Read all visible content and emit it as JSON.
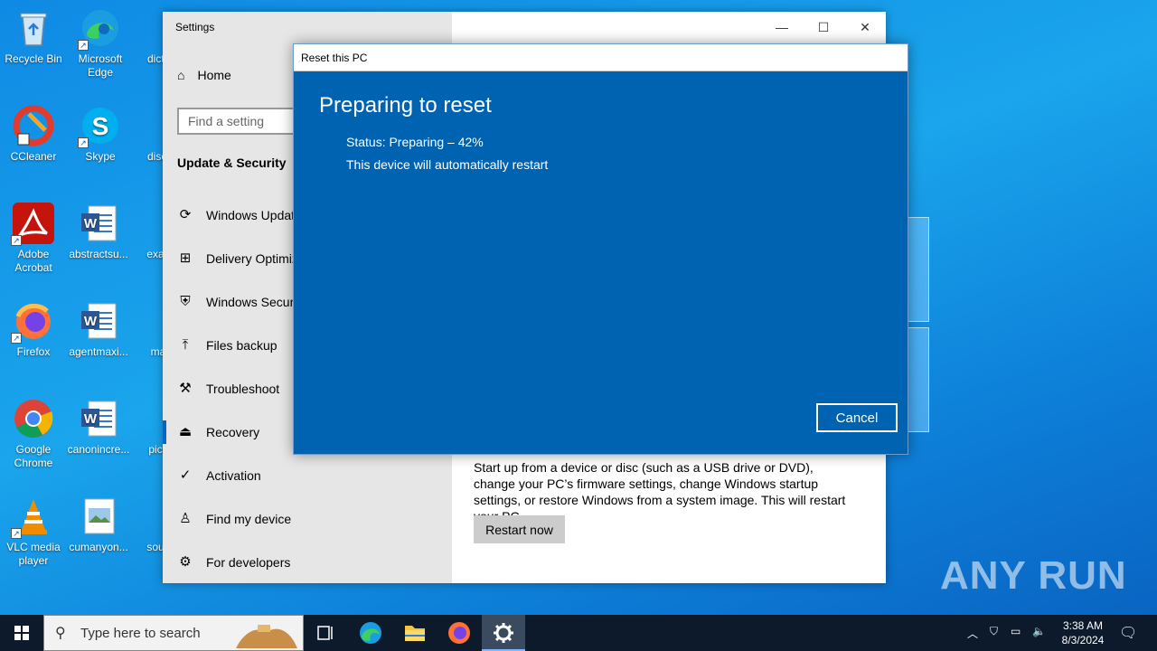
{
  "desktop": {
    "icons": [
      {
        "label": "Recycle Bin"
      },
      {
        "label": "Microsoft Edge"
      },
      {
        "label": "dictio"
      },
      {
        "label": "CCleaner"
      },
      {
        "label": "Skype"
      },
      {
        "label": "discu"
      },
      {
        "label": "Adobe Acrobat"
      },
      {
        "label": "abstractsu..."
      },
      {
        "label": "exam"
      },
      {
        "label": "Firefox"
      },
      {
        "label": "agentmaxi..."
      },
      {
        "label": "mar"
      },
      {
        "label": "Google Chrome"
      },
      {
        "label": "canonincre..."
      },
      {
        "label": "pictu"
      },
      {
        "label": "VLC media player"
      },
      {
        "label": "cumanyon..."
      },
      {
        "label": "south"
      }
    ],
    "watermark": "ANY RUN"
  },
  "settings": {
    "title": "Settings",
    "home": "Home",
    "search_placeholder": "Find a setting",
    "section": "Update & Security",
    "nav": [
      {
        "label": "Windows Update",
        "icon": "sync-icon"
      },
      {
        "label": "Delivery Optimization",
        "icon": "delivery-icon"
      },
      {
        "label": "Windows Security",
        "icon": "shield-icon"
      },
      {
        "label": "Files backup",
        "icon": "upload-icon"
      },
      {
        "label": "Troubleshoot",
        "icon": "wrench-icon"
      },
      {
        "label": "Recovery",
        "icon": "recovery-icon"
      },
      {
        "label": "Activation",
        "icon": "check-circle-icon"
      },
      {
        "label": "Find my device",
        "icon": "person-location-icon"
      },
      {
        "label": "For developers",
        "icon": "developer-icon"
      }
    ],
    "active_nav": "Recovery",
    "advanced_startup_text": "Start up from a device or disc (such as a USB drive or DVD), change your PC’s firmware settings, change Windows startup settings, or restore Windows from a system image. This will restart your PC.",
    "restart_now": "Restart now"
  },
  "dialog": {
    "title": "Reset this PC",
    "heading": "Preparing to reset",
    "status": "Status: Preparing – 42%",
    "note": "This device will automatically restart",
    "cancel": "Cancel"
  },
  "taskbar": {
    "search_placeholder": "Type here to search",
    "time": "3:38 AM",
    "date": "8/3/2024"
  },
  "colors": {
    "dialog_bg": "#0063b1",
    "accent": "#0067c0",
    "taskbar": "#0c1a2b"
  }
}
